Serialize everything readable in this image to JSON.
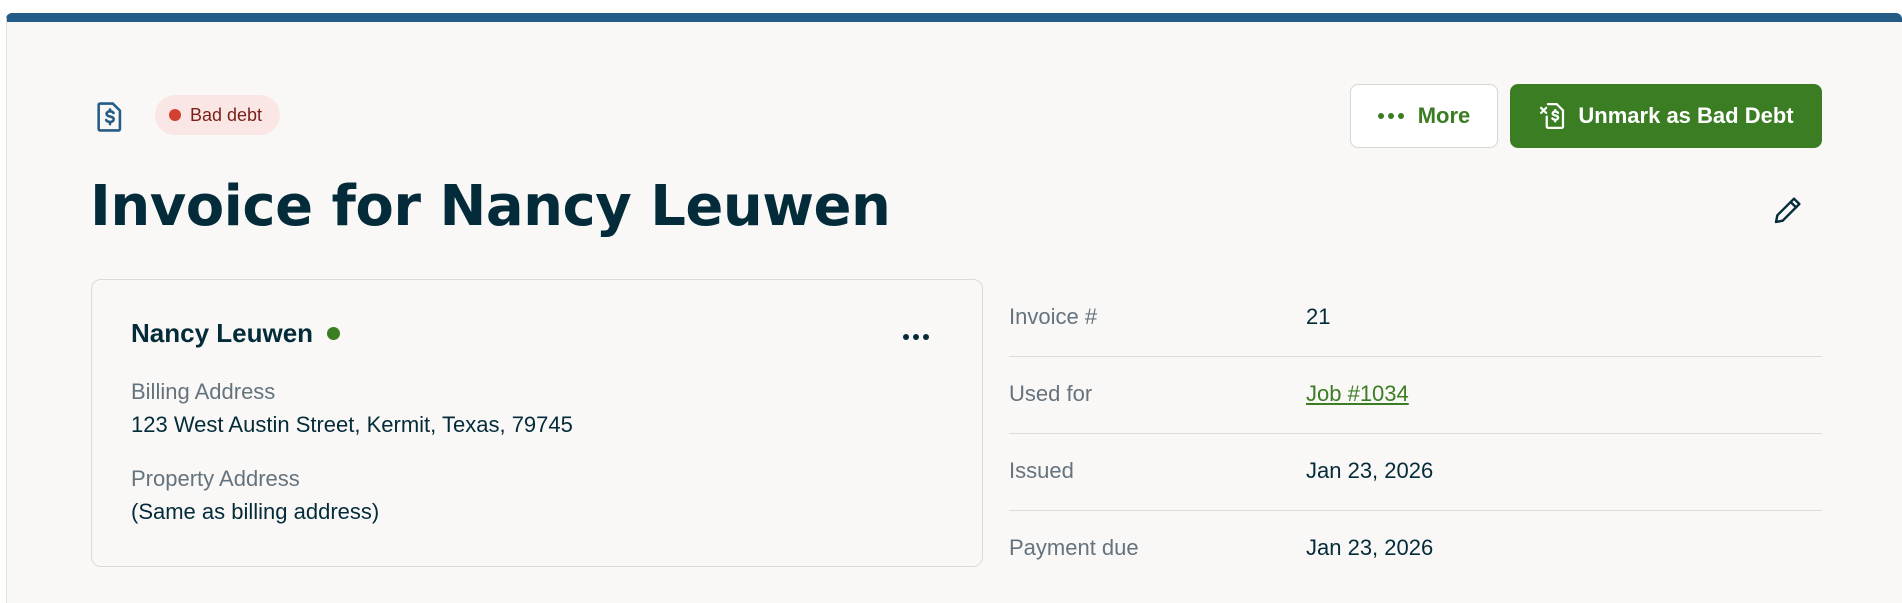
{
  "header": {
    "badge_label": "Bad debt",
    "more_label": "More",
    "unmark_label": "Unmark as Bad Debt",
    "title": "Invoice for Nancy Leuwen"
  },
  "client": {
    "name": "Nancy Leuwen",
    "billing_label": "Billing Address",
    "billing_value": "123 West Austin Street, Kermit, Texas, 79745",
    "property_label": "Property Address",
    "property_value": "(Same as billing address)"
  },
  "details": [
    {
      "label": "Invoice #",
      "value": "21"
    },
    {
      "label": "Used for",
      "value": "Job #1034"
    },
    {
      "label": "Issued",
      "value": "Jan 23, 2026"
    },
    {
      "label": "Payment due",
      "value": "Jan 23, 2026"
    }
  ],
  "colors": {
    "accent_bar": "#255c87",
    "primary_green": "#3a7d22",
    "bad_debt_dot": "#d2402f",
    "text_dark": "#032b3a",
    "text_muted": "#65737e"
  },
  "icons": [
    "invoice-document-icon",
    "more-dots-icon",
    "bad-debt-icon",
    "pencil-edit-icon",
    "client-online-status-icon",
    "client-menu-dots-icon"
  ]
}
